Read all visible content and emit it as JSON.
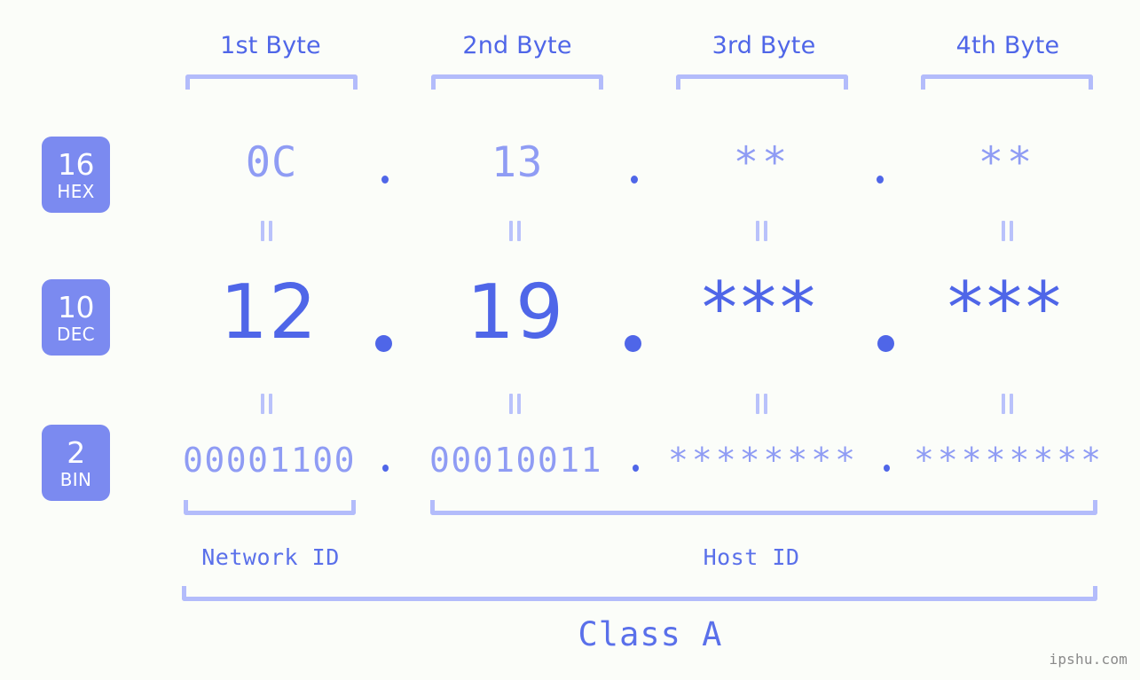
{
  "watermark": "ipshu.com",
  "byte_headers": [
    {
      "label": "1st Byte"
    },
    {
      "label": "2nd Byte"
    },
    {
      "label": "3rd Byte"
    },
    {
      "label": "4th Byte"
    }
  ],
  "radix_badges": [
    {
      "number": "16",
      "name": "HEX"
    },
    {
      "number": "10",
      "name": "DEC"
    },
    {
      "number": "2",
      "name": "BIN"
    }
  ],
  "rows": {
    "hex": {
      "radix": "16",
      "values": [
        "0C",
        "13",
        "**",
        "**"
      ]
    },
    "dec": {
      "radix": "10",
      "values": [
        "12",
        "19",
        "***",
        "***"
      ]
    },
    "bin": {
      "radix": "2",
      "values": [
        "00001100",
        "00010011",
        "********",
        "********"
      ]
    }
  },
  "separators": {
    "dot": "."
  },
  "connectors": {
    "equals": "||"
  },
  "sections": {
    "network_id": "Network ID",
    "host_id": "Host ID",
    "class": "Class A"
  },
  "colors": {
    "background": "#fbfdf9",
    "badge_fill": "#7b8af0",
    "badge_text": "#ffffff",
    "accent_strong": "#4f66e8",
    "accent_light": "#8f9cf4",
    "bracket": "#b3bcfb",
    "watermark_text": "#8a8a8a"
  }
}
